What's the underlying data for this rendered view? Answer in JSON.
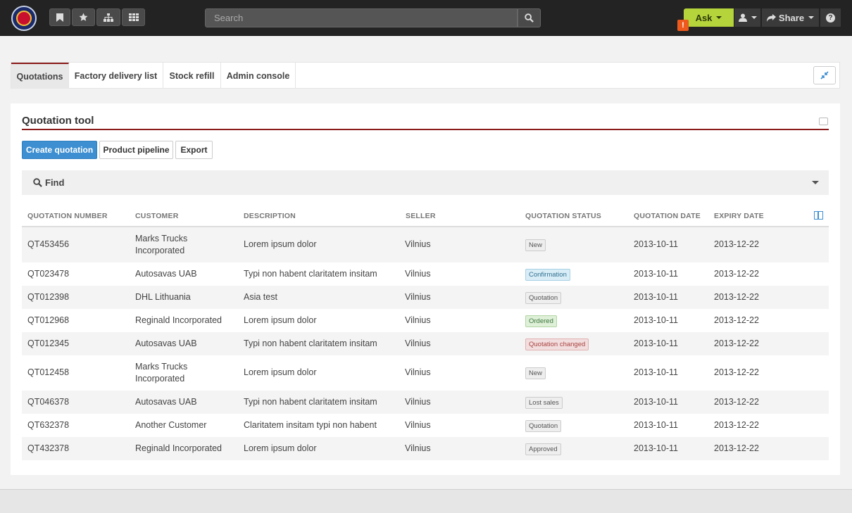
{
  "header": {
    "search_placeholder": "Search",
    "ask_label": "Ask",
    "alert_count": "!",
    "share_label": "Share",
    "help_label": "?"
  },
  "tabs": [
    {
      "label": "Quotations",
      "active": true
    },
    {
      "label": "Factory delivery list",
      "active": false
    },
    {
      "label": "Stock refill",
      "active": false
    },
    {
      "label": "Admin console",
      "active": false
    }
  ],
  "panel": {
    "title": "Quotation tool",
    "buttons": {
      "create": "Create quotation",
      "pipeline": "Product pipeline",
      "export": "Export"
    },
    "find_label": "Find"
  },
  "table": {
    "columns": [
      "QUOTATION NUMBER",
      "CUSTOMER",
      "DESCRIPTION",
      "SELLER",
      "QUOTATION STATUS",
      "QUOTATION DATE",
      "EXPIRY DATE"
    ],
    "rows": [
      {
        "number": "QT453456",
        "customer": "Marks Trucks Incorporated",
        "description": "Lorem ipsum dolor",
        "seller": "Vilnius",
        "status": "New",
        "status_type": "default",
        "date": "2013-10-11",
        "expiry": "2013-12-22"
      },
      {
        "number": "QT023478",
        "customer": "Autosavas UAB",
        "description": "Typi non habent claritatem insitam",
        "seller": "Vilnius",
        "status": "Confirmation",
        "status_type": "confirmation",
        "date": "2013-10-11",
        "expiry": "2013-12-22"
      },
      {
        "number": "QT012398",
        "customer": "DHL Lithuania",
        "description": "Asia test",
        "seller": "Vilnius",
        "status": "Quotation",
        "status_type": "default",
        "date": "2013-10-11",
        "expiry": "2013-12-22"
      },
      {
        "number": "QT012968",
        "customer": "Reginald Incorporated",
        "description": "Lorem ipsum dolor",
        "seller": "Vilnius",
        "status": "Ordered",
        "status_type": "ordered",
        "date": "2013-10-11",
        "expiry": "2013-12-22"
      },
      {
        "number": "QT012345",
        "customer": "Autosavas UAB",
        "description": "Typi non habent claritatem insitam",
        "seller": "Vilnius",
        "status": "Quotation changed",
        "status_type": "changed",
        "date": "2013-10-11",
        "expiry": "2013-12-22"
      },
      {
        "number": "QT012458",
        "customer": "Marks Trucks Incorporated",
        "description": "Lorem ipsum dolor",
        "seller": "Vilnius",
        "status": "New",
        "status_type": "default",
        "date": "2013-10-11",
        "expiry": "2013-12-22"
      },
      {
        "number": "QT046378",
        "customer": "Autosavas UAB",
        "description": "Typi non habent claritatem insitam",
        "seller": "Vilnius",
        "status": "Lost sales",
        "status_type": "default",
        "date": "2013-10-11",
        "expiry": "2013-12-22"
      },
      {
        "number": "QT632378",
        "customer": "Another Customer",
        "description": "Claritatem insitam typi non habent",
        "seller": "Vilnius",
        "status": "Quotation",
        "status_type": "default",
        "date": "2013-10-11",
        "expiry": "2013-12-22"
      },
      {
        "number": "QT432378",
        "customer": "Reginald Incorporated",
        "description": "Lorem ipsum dolor",
        "seller": "Vilnius",
        "status": "Approved",
        "status_type": "default",
        "date": "2013-10-11",
        "expiry": "2013-12-22"
      }
    ]
  },
  "colors": {
    "accent": "#8b1a1a",
    "primary_button": "#3d8fd1",
    "ask_button": "#b5d33a",
    "topbar": "#232323"
  },
  "icons": [
    "logo",
    "bookmark-icon",
    "star-icon",
    "sitemap-icon",
    "grid-icon",
    "search-icon",
    "user-icon",
    "share-icon",
    "help-icon",
    "chevron-up-icon",
    "compress-icon",
    "columns-icon"
  ]
}
